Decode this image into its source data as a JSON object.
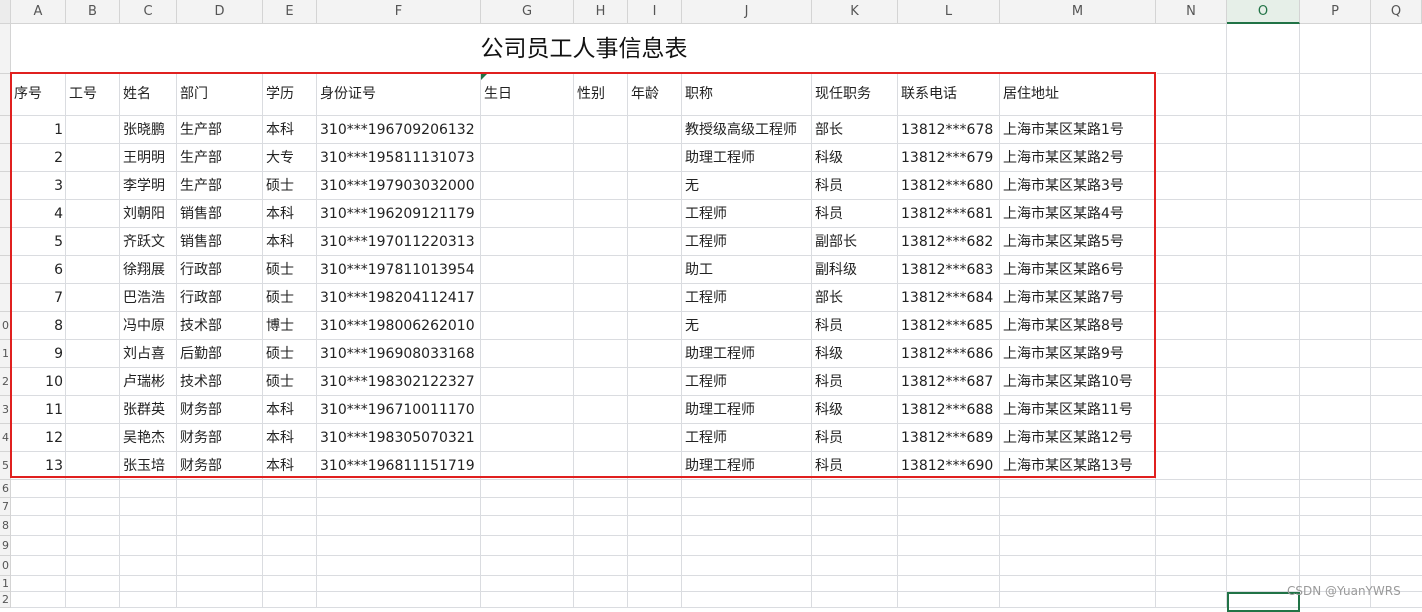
{
  "columns": [
    "A",
    "B",
    "C",
    "D",
    "E",
    "F",
    "G",
    "H",
    "I",
    "J",
    "K",
    "L",
    "M",
    "N",
    "O",
    "P",
    "Q"
  ],
  "selected_column": "O",
  "row_numbers": [
    "",
    "",
    "",
    "",
    "",
    "",
    "",
    "",
    "",
    "0",
    "1",
    "2",
    "3",
    "4",
    "5",
    "6",
    "7",
    "8",
    "9",
    "0",
    "1",
    "2"
  ],
  "title": "公司员工人事信息表",
  "headers": [
    "序号",
    "工号",
    "姓名",
    "部门",
    "学历",
    "身份证号",
    "生日",
    "性别",
    "年龄",
    "职称",
    "现任职务",
    "联系电话",
    "居住地址"
  ],
  "rows": [
    [
      "1",
      "",
      "张晓鹏",
      "生产部",
      "本科",
      "310***196709206132",
      "",
      "",
      "",
      "教授级高级工程师",
      "部长",
      "13812***678",
      "上海市某区某路1号"
    ],
    [
      "2",
      "",
      "王明明",
      "生产部",
      "大专",
      "310***195811131073",
      "",
      "",
      "",
      "助理工程师",
      "科级",
      "13812***679",
      "上海市某区某路2号"
    ],
    [
      "3",
      "",
      "李学明",
      "生产部",
      "硕士",
      "310***197903032000",
      "",
      "",
      "",
      "无",
      "科员",
      "13812***680",
      "上海市某区某路3号"
    ],
    [
      "4",
      "",
      "刘朝阳",
      "销售部",
      "本科",
      "310***196209121179",
      "",
      "",
      "",
      "工程师",
      "科员",
      "13812***681",
      "上海市某区某路4号"
    ],
    [
      "5",
      "",
      "齐跃文",
      "销售部",
      "本科",
      "310***197011220313",
      "",
      "",
      "",
      "工程师",
      "副部长",
      "13812***682",
      "上海市某区某路5号"
    ],
    [
      "6",
      "",
      "徐翔展",
      "行政部",
      "硕士",
      "310***197811013954",
      "",
      "",
      "",
      "助工",
      "副科级",
      "13812***683",
      "上海市某区某路6号"
    ],
    [
      "7",
      "",
      "巴浩浩",
      "行政部",
      "硕士",
      "310***198204112417",
      "",
      "",
      "",
      "工程师",
      "部长",
      "13812***684",
      "上海市某区某路7号"
    ],
    [
      "8",
      "",
      "冯中原",
      "技术部",
      "博士",
      "310***198006262010",
      "",
      "",
      "",
      "无",
      "科员",
      "13812***685",
      "上海市某区某路8号"
    ],
    [
      "9",
      "",
      "刘占喜",
      "后勤部",
      "硕士",
      "310***196908033168",
      "",
      "",
      "",
      "助理工程师",
      "科级",
      "13812***686",
      "上海市某区某路9号"
    ],
    [
      "10",
      "",
      "卢瑞彬",
      "技术部",
      "硕士",
      "310***198302122327",
      "",
      "",
      "",
      "工程师",
      "科员",
      "13812***687",
      "上海市某区某路10号"
    ],
    [
      "11",
      "",
      "张群英",
      "财务部",
      "本科",
      "310***196710011170",
      "",
      "",
      "",
      "助理工程师",
      "科级",
      "13812***688",
      "上海市某区某路11号"
    ],
    [
      "12",
      "",
      "吴艳杰",
      "财务部",
      "本科",
      "310***198305070321",
      "",
      "",
      "",
      "工程师",
      "科员",
      "13812***689",
      "上海市某区某路12号"
    ],
    [
      "13",
      "",
      "张玉培",
      "财务部",
      "本科",
      "310***196811151719",
      "",
      "",
      "",
      "助理工程师",
      "科员",
      "13812***690",
      "上海市某区某路13号"
    ]
  ],
  "watermark": "CSDN @YuanYWRS",
  "colors": {
    "highlight_border": "#e0201f",
    "selection": "#217346"
  }
}
